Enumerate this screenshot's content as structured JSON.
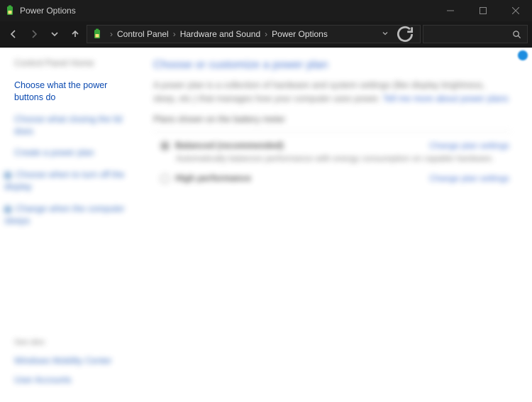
{
  "window": {
    "title": "Power Options"
  },
  "breadcrumb": {
    "items": [
      "Control Panel",
      "Hardware and Sound",
      "Power Options"
    ]
  },
  "sidebar": {
    "home": "Control Panel Home",
    "choose_buttons": "Choose what the power buttons do",
    "closing_lid": "Choose what closing the lid does",
    "create_plan": "Create a power plan",
    "turn_off_display": "Choose when to turn off the display",
    "sleep": "Change when the computer sleeps",
    "see_also": "See also",
    "mobility": "Windows Mobility Center",
    "accounts": "User Accounts"
  },
  "main": {
    "heading": "Choose or customize a power plan",
    "intro": "A power plan is a collection of hardware and system settings (like display brightness, sleep, etc.) that manages how your computer uses power.",
    "intro_link": "Tell me more about power plans",
    "shown_on": "Plans shown on the battery meter",
    "plan1_name": "Balanced (recommended)",
    "plan1_desc": "Automatically balances performance with energy consumption on capable hardware.",
    "plan2_name": "High performance",
    "change_settings": "Change plan settings"
  }
}
